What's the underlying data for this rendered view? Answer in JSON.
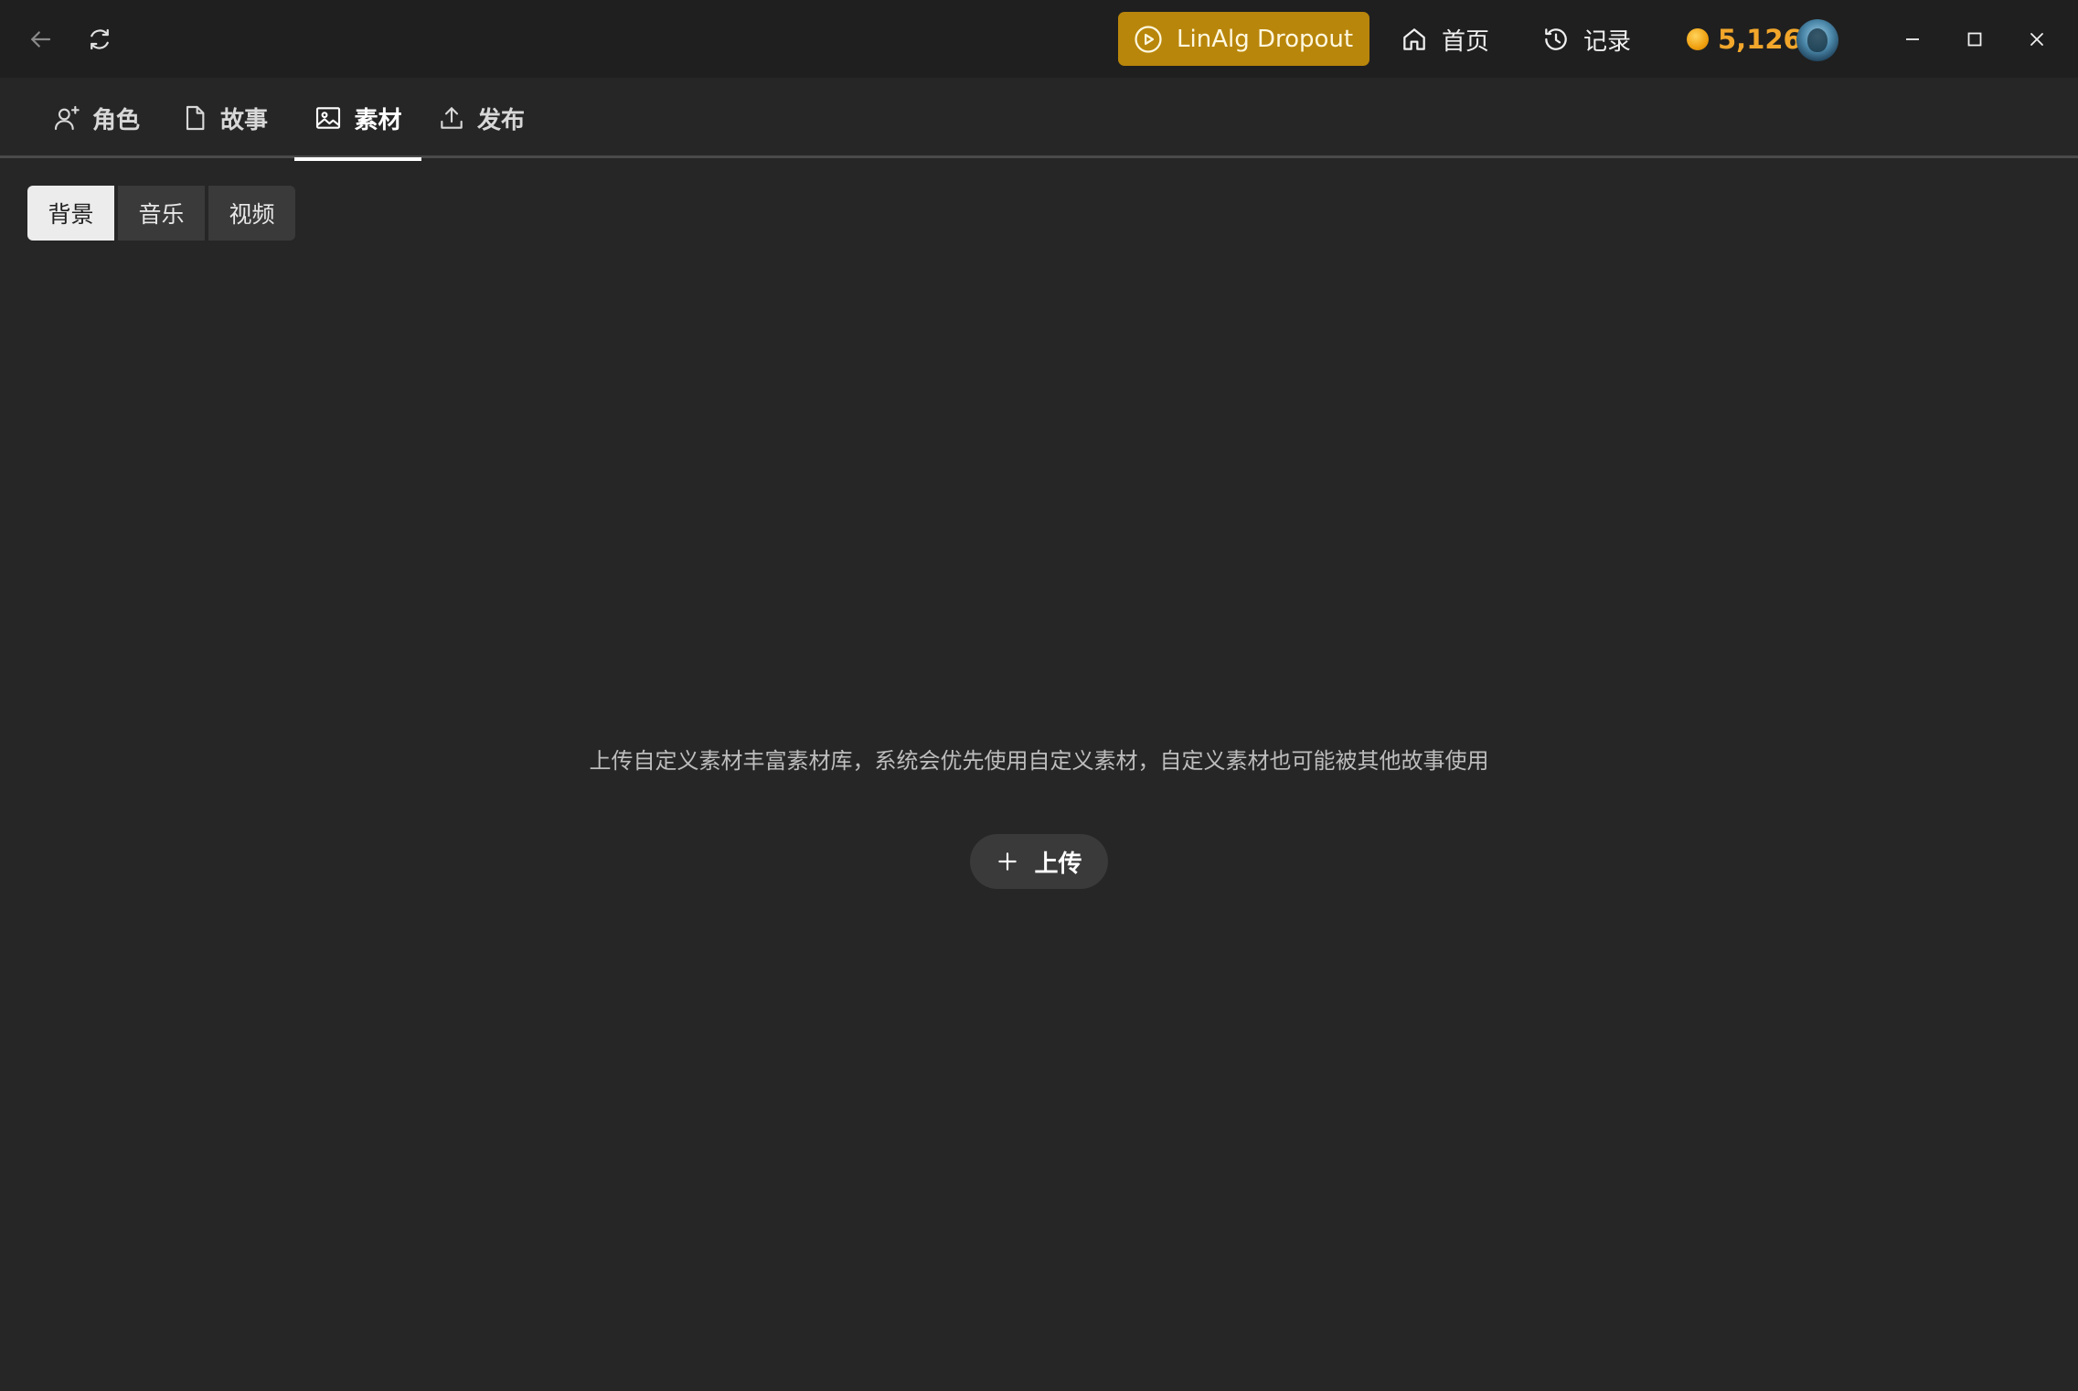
{
  "titlebar": {
    "play_label": "LinAlg Dropout",
    "home_label": "首页",
    "history_label": "记录",
    "coins": "5,126"
  },
  "tabs": [
    {
      "label": "角色",
      "icon": "user-plus-icon"
    },
    {
      "label": "故事",
      "icon": "document-icon"
    },
    {
      "label": "素材",
      "icon": "image-icon"
    },
    {
      "label": "发布",
      "icon": "upload-icon"
    }
  ],
  "active_tab": "素材",
  "subtabs": [
    {
      "label": "背景"
    },
    {
      "label": "音乐"
    },
    {
      "label": "视频"
    }
  ],
  "active_subtab": "背景",
  "empty_state": {
    "message": "上传自定义素材丰富素材库，系统会优先使用自定义素材，自定义素材也可能被其他故事使用",
    "upload_label": "上传"
  },
  "colors": {
    "background": "#262626",
    "titlebar": "#1f1f1f",
    "accent_gold": "#b8860b",
    "coin_text": "#f2a72b"
  }
}
